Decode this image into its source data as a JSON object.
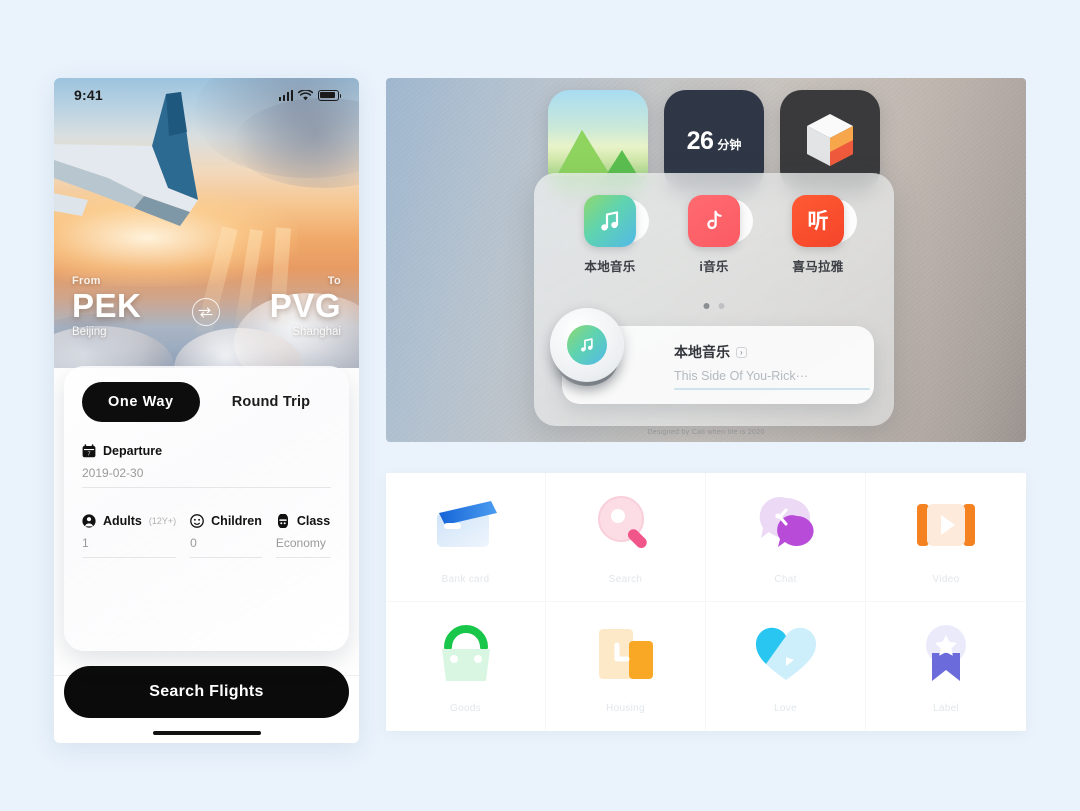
{
  "page": {
    "background_color": "#eaf3fc"
  },
  "phone": {
    "status_bar": {
      "time": "9:41",
      "signal_icon": "cellular-signal-icon",
      "wifi_icon": "wifi-icon",
      "battery_icon": "battery-icon"
    },
    "route": {
      "from_label": "From",
      "from_code": "PEK",
      "from_city": "Beijing",
      "to_label": "To",
      "to_code": "PVG",
      "to_city": "Shanghai",
      "swap_icon": "swap-arrows-icon"
    },
    "search_card": {
      "trip_tabs": [
        {
          "label": "One  Way",
          "active": true
        },
        {
          "label": "Round Trip",
          "active": false
        }
      ],
      "departure": {
        "icon": "calendar-icon",
        "label": "Departure",
        "value": "2019-02-30"
      },
      "passengers": [
        {
          "icon": "person-icon",
          "label": "Adults",
          "sublabel": "(12Y+)",
          "value": "1"
        },
        {
          "icon": "child-face-icon",
          "label": "Children",
          "sublabel": "",
          "value": "0"
        },
        {
          "icon": "seat-class-icon",
          "label": "Class",
          "sublabel": "",
          "value": "Economy"
        }
      ]
    },
    "search_button": {
      "label": "Search Flights",
      "background_color": "#0b0b0b",
      "text_color": "#ffffff"
    },
    "tabbar": [
      {
        "icon": "airplane-icon",
        "name": "flights",
        "active": true
      },
      {
        "icon": "heart-icon",
        "name": "favorites",
        "active": false
      },
      {
        "icon": "clipboard-icon",
        "name": "orders",
        "active": false
      },
      {
        "icon": "profile-icon",
        "name": "profile",
        "active": false
      }
    ]
  },
  "widget_panel": {
    "widgets": [
      {
        "name": "photos-widget",
        "type": "photo",
        "label": ""
      },
      {
        "name": "timer-widget",
        "type": "timer",
        "number": "26",
        "unit": "分钟",
        "background_color": "#2f3746"
      },
      {
        "name": "cube-widget",
        "type": "cube",
        "background_color": "#3a3a3c"
      }
    ],
    "apps": [
      {
        "icon": "music-note-icon",
        "label": "本地音乐",
        "color": "#5fd3b0"
      },
      {
        "icon": "tiktok-music-icon",
        "label": "i音乐",
        "color": "#fb5a63"
      },
      {
        "icon": "ting-icon",
        "label": "喜马拉雅",
        "color": "#f4452a",
        "glyph": "听"
      }
    ],
    "page_dots": {
      "total": 2,
      "active_index": 0
    },
    "player": {
      "app_icon": "music-disc-icon",
      "title": "本地音乐",
      "badge": "›",
      "track": "This Side Of You-Rick···"
    },
    "credit": "Designed by Cali  when life is 2020"
  },
  "icon_grid": {
    "items": [
      {
        "icon": "bank-card-icon",
        "label": "Bank card",
        "color": "#1d7ae8"
      },
      {
        "icon": "search-magnifier-icon",
        "label": "Search",
        "color": "#f0568a"
      },
      {
        "icon": "chat-bubbles-icon",
        "label": "Chat",
        "color": "#b84cd8"
      },
      {
        "icon": "video-play-icon",
        "label": "Video",
        "color": "#f58220"
      },
      {
        "icon": "shopping-bag-icon",
        "label": "Goods",
        "color": "#18c64a"
      },
      {
        "icon": "housing-folder-icon",
        "label": "Housing",
        "color": "#f9a825"
      },
      {
        "icon": "love-heart-icon",
        "label": "Love",
        "color": "#29c6f2"
      },
      {
        "icon": "label-star-icon",
        "label": "Label",
        "color": "#6b6bdb"
      }
    ]
  }
}
